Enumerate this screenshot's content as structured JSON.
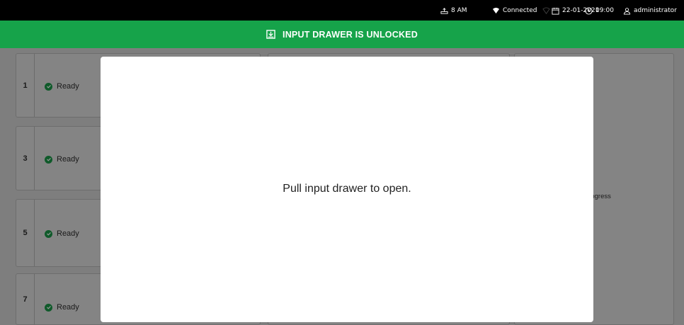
{
  "statusbar": {
    "time_label": "8 AM",
    "connection": "Connected",
    "date": "22-01-2021",
    "clock": "09:00",
    "user": "administrator"
  },
  "banner": {
    "text": "INPUT DRAWER IS UNLOCKED"
  },
  "positions": [
    {
      "number": "1",
      "status": "Ready"
    },
    {
      "number": "3",
      "status": "Ready"
    },
    {
      "number": "5",
      "status": "Ready"
    },
    {
      "number": "7",
      "status": "Ready"
    }
  ],
  "right_panel": {
    "status_text": "n progress"
  },
  "modal": {
    "message": "Pull input drawer to open."
  },
  "colors": {
    "banner": "#16a34a",
    "statusbar": "#000000",
    "overlay": "#7e7e7e"
  }
}
